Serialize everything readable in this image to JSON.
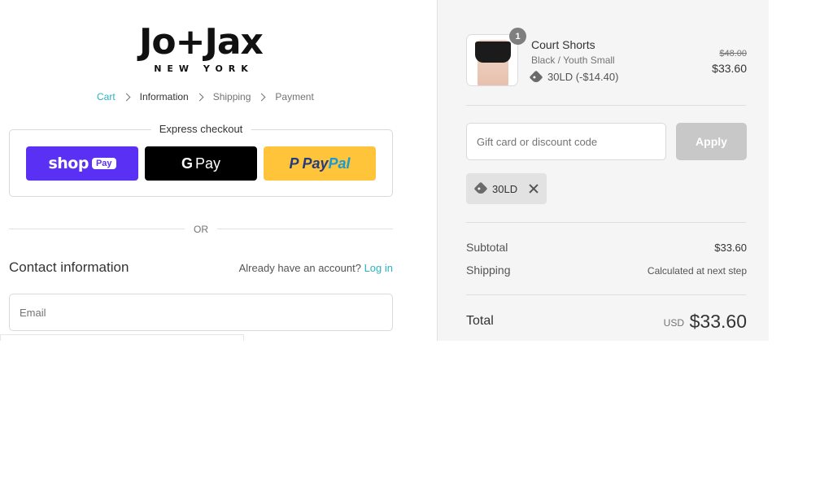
{
  "brand": {
    "name": "Jo+Jax",
    "tagline": "NEW YORK"
  },
  "breadcrumb": [
    "Cart",
    "Information",
    "Shipping",
    "Payment"
  ],
  "express": {
    "title": "Express checkout",
    "shop_pay": {
      "word": "shop",
      "pill": "Pay"
    },
    "google_pay": {
      "g": "G",
      "word": "Pay"
    },
    "paypal": {
      "mark": "P",
      "word1": "Pay",
      "word2": "Pal"
    }
  },
  "divider_text": "OR",
  "contact": {
    "title": "Contact information",
    "account_prompt": "Already have an account?",
    "login_label": "Log in",
    "email_placeholder": "Email"
  },
  "cart": {
    "quantity": "1",
    "product_name": "Court Shorts",
    "variant": "Black / Youth Small",
    "discount_line": "30LD (-$14.40)",
    "original_price": "$48.00",
    "price": "$33.60"
  },
  "discount": {
    "placeholder": "Gift card or discount code",
    "apply_label": "Apply",
    "applied_code": "30LD"
  },
  "summary": {
    "subtotal_label": "Subtotal",
    "subtotal_value": "$33.60",
    "shipping_label": "Shipping",
    "shipping_value": "Calculated at next step",
    "total_label": "Total",
    "currency": "USD",
    "total_value": "$33.60"
  },
  "colors": {
    "accent": "#2bb3c0",
    "shop_pay": "#5a31f4",
    "paypal": "#ffc439",
    "apply_disabled": "#c8c8c8"
  }
}
